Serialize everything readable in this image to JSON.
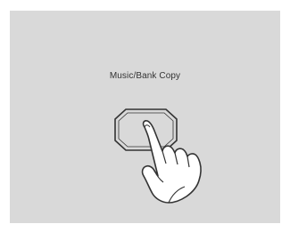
{
  "label": "Music/Bank Copy",
  "colors": {
    "page_background": "#ffffff",
    "panel_background": "#d9d9d9",
    "stroke": "#333333",
    "hand_fill": "#ffffff"
  },
  "icons": {
    "button": "octagon-button-icon",
    "hand": "pointing-hand-icon"
  }
}
